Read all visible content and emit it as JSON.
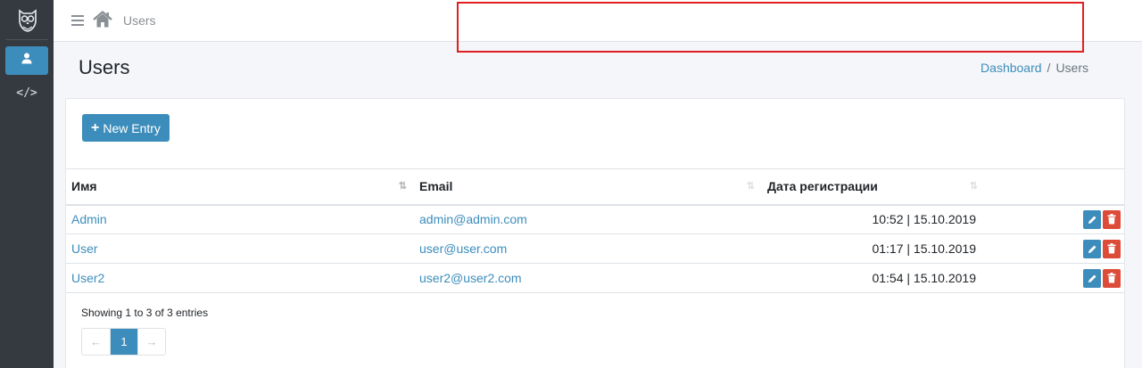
{
  "sidebar": {
    "logo_icon": "owl-logo-icon",
    "items": [
      {
        "icon": "user-icon",
        "active": true
      },
      {
        "icon": "code-icon",
        "glyph": "</>",
        "active": false
      }
    ]
  },
  "topbar": {
    "menu_icon": "hamburger-menu-icon",
    "home_icon": "home-icon",
    "title": "Users"
  },
  "page": {
    "title": "Users",
    "breadcrumb": [
      "Dashboard",
      "Users"
    ],
    "breadcrumb_sep": "/"
  },
  "toolbar": {
    "new_entry_plus": "+",
    "new_entry_label": "New Entry"
  },
  "table": {
    "columns": [
      "Имя",
      "Email",
      "Дата регистрации"
    ],
    "rows": [
      {
        "name": "Admin",
        "email": "admin@admin.com",
        "date": "10:52 | 15.10.2019"
      },
      {
        "name": "User",
        "email": "user@user.com",
        "date": "01:17 | 15.10.2019"
      },
      {
        "name": "User2",
        "email": "user2@user2.com",
        "date": "01:54 | 15.10.2019"
      }
    ],
    "sort_indicators": [
      "⇅",
      "⇅",
      "⇅"
    ]
  },
  "footer": {
    "info": "Showing 1 to 3 of 3 entries",
    "pagination": {
      "prev": "←",
      "current": "1",
      "next": "→"
    }
  },
  "colors": {
    "accent": "#3c8dbc",
    "danger": "#dd4b39",
    "sidebar_bg": "#343a40",
    "highlight": "#e02020"
  }
}
